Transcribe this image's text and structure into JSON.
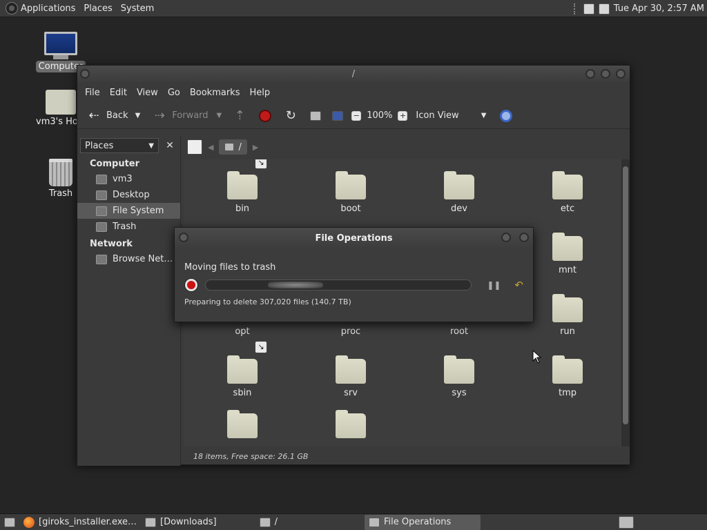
{
  "top_panel": {
    "applications": "Applications",
    "places": "Places",
    "system": "System",
    "clock": "Tue Apr 30,  2:57 AM"
  },
  "desktop": {
    "icons": [
      {
        "label": "Computer",
        "icon": "computer-icon"
      },
      {
        "label": "vm3's Home",
        "icon": "home-folder-icon"
      },
      {
        "label": "Trash",
        "icon": "trash-icon"
      }
    ]
  },
  "window": {
    "title": "/",
    "menu": [
      "File",
      "Edit",
      "View",
      "Go",
      "Bookmarks",
      "Help"
    ],
    "toolbar": {
      "back": "Back",
      "forward": "Forward",
      "zoom": "100%",
      "view_mode": "Icon View"
    },
    "sidebar": {
      "combo": "Places",
      "computer_header": "Computer",
      "computer_items": [
        "vm3",
        "Desktop",
        "File System",
        "Trash"
      ],
      "network_header": "Network",
      "network_items": [
        "Browse Net…"
      ]
    },
    "location": "/",
    "folders": [
      "bin",
      "boot",
      "dev",
      "etc",
      "mnt",
      "opt",
      "proc",
      "root",
      "run",
      "sbin",
      "srv",
      "sys",
      "tmp"
    ],
    "status": "18 items, Free space: 26.1 GB"
  },
  "file_operations": {
    "title": "File Operations",
    "action": "Moving files to trash",
    "details": "Preparing to delete 307,020 files (140.7 TB)"
  },
  "taskbar": {
    "items": [
      "[giroks_installer.exe…",
      "[Downloads]",
      "/",
      "File Operations"
    ]
  },
  "colors": {
    "panel": "#3a3a3a",
    "desktop": "#252525",
    "stop_red": "#c21a1a",
    "folder": "#d4d4c0"
  }
}
